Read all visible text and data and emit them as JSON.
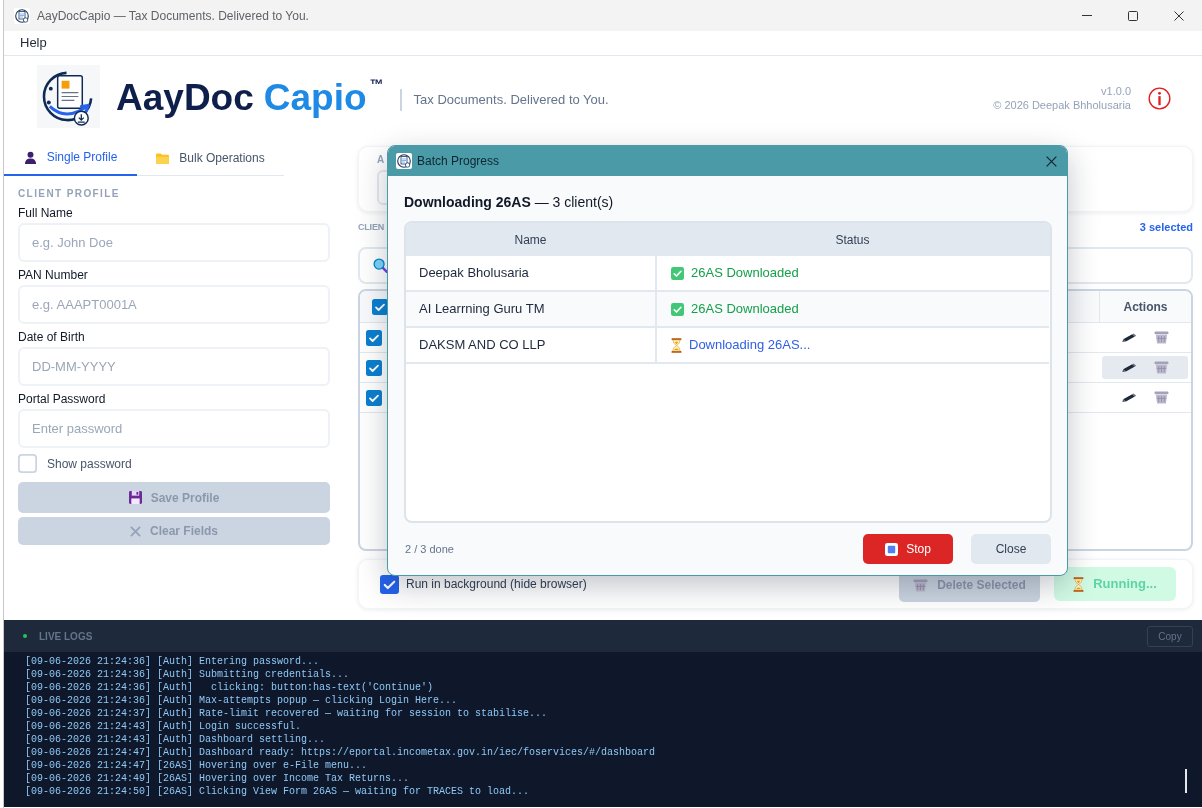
{
  "window": {
    "title": "AayDocCapio — Tax Documents. Delivered to You."
  },
  "menu": [
    {
      "label": "Help"
    }
  ],
  "header": {
    "brand_primary": "AayDoc",
    "brand_secondary": "Capio",
    "trademark": "™",
    "tagline": "Tax Documents. Delivered to You.",
    "version": "v1.0.0",
    "copyright": "© 2026 Deepak Bhholusaria"
  },
  "tabs": [
    {
      "label": "Single Profile",
      "selected": true
    },
    {
      "label": "Bulk Operations",
      "selected": false
    }
  ],
  "client_profile": {
    "heading": "CLIENT PROFILE",
    "fields": [
      {
        "label": "Full Name",
        "placeholder": "e.g. John Doe"
      },
      {
        "label": "PAN Number",
        "placeholder": "e.g. AAAPT0001A"
      },
      {
        "label": "Date of Birth",
        "placeholder": "DD-MM-YYYY"
      },
      {
        "label": "Portal Password",
        "placeholder": "Enter password"
      }
    ],
    "show_password": {
      "label": "Show password",
      "checked": false
    },
    "buttons": [
      {
        "label": "Save Profile",
        "disabled": true
      },
      {
        "label": "Clear Fields",
        "disabled": true
      }
    ]
  },
  "action_card": {
    "label": "A"
  },
  "clients": {
    "label": "CLIEN",
    "selected_count": "3 selected"
  },
  "clients_table": {
    "select_all": {
      "checked": true
    },
    "columns": [
      {
        "label": "Actions"
      }
    ],
    "rows": [
      {
        "checked": true,
        "highlighted": false
      },
      {
        "checked": true,
        "highlighted": true
      },
      {
        "checked": true,
        "highlighted": false
      }
    ]
  },
  "footer_bar": {
    "run_in_background": {
      "label": "Run in background (hide browser)",
      "checked": true
    },
    "buttons": [
      {
        "kind": "delete",
        "label": "Delete Selected",
        "disabled": true
      },
      {
        "kind": "running",
        "label": "Running..."
      }
    ]
  },
  "logs": {
    "title": "LIVE LOGS",
    "copy_label": "Copy",
    "lines": [
      "[09-06-2026 21:24:36] [Auth] Entering password...",
      "[09-06-2026 21:24:36] [Auth] Submitting credentials...",
      "[09-06-2026 21:24:36] [Auth]   clicking: button:has-text('Continue')",
      "[09-06-2026 21:24:36] [Auth] Max-attempts popup — clicking Login Here...",
      "[09-06-2026 21:24:37] [Auth] Rate-limit recovered — waiting for session to stabilise...",
      "[09-06-2026 21:24:43] [Auth] Login successful.",
      "[09-06-2026 21:24:43] [Auth] Dashboard settling...",
      "[09-06-2026 21:24:47] [Auth] Dashboard ready: https://eportal.incometax.gov.in/iec/foservices/#/dashboard",
      "[09-06-2026 21:24:47] [26AS] Hovering over e-File menu...",
      "[09-06-2026 21:24:49] [26AS] Hovering over Income Tax Returns...",
      "[09-06-2026 21:24:50] [26AS] Clicking View Form 26AS — waiting for TRACES to load..."
    ]
  },
  "batch_dialog": {
    "title": "Batch Progress",
    "heading": "**Downloading 26AS** — 3 client(s)",
    "columns": [
      {
        "label": "Name"
      },
      {
        "label": "Status"
      }
    ],
    "rows": [
      {
        "name": "Deepak Bholusaria",
        "status": "26AS Downloaded",
        "kind": "done"
      },
      {
        "name": "AI Learrning Guru TM",
        "status": "26AS Downloaded",
        "kind": "done"
      },
      {
        "name": "DAKSM AND CO LLP",
        "status": "Downloading 26AS...",
        "kind": "in_progress"
      }
    ],
    "progress_text": "2 / 3 done",
    "buttons": [
      {
        "kind": "stop",
        "label": "Stop"
      },
      {
        "kind": "close",
        "label": "Close"
      }
    ]
  }
}
